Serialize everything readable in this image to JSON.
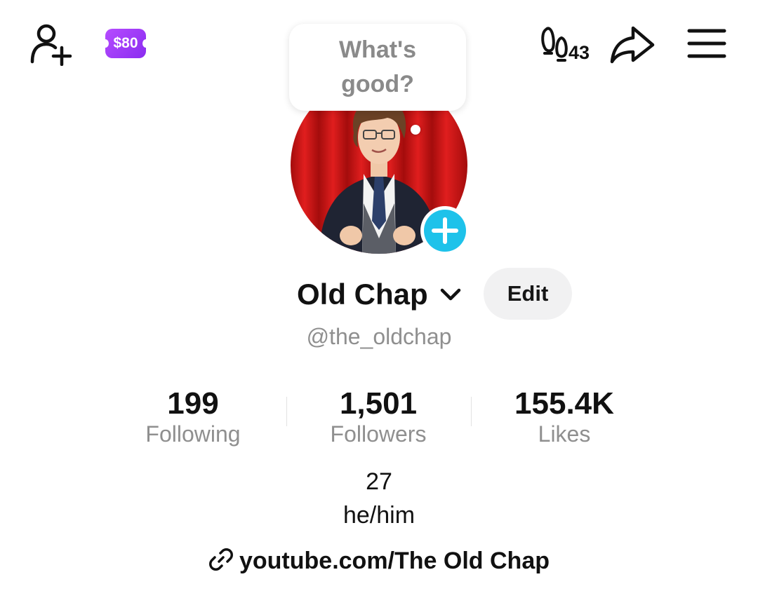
{
  "topbar": {
    "coin_badge": "$80",
    "visitors_count": "43"
  },
  "bubble": {
    "text": "What's good?"
  },
  "profile": {
    "display_name": "Old Chap",
    "edit_label": "Edit",
    "handle": "@the_oldchap"
  },
  "stats": [
    {
      "value": "199",
      "label": "Following"
    },
    {
      "value": "1,501",
      "label": "Followers"
    },
    {
      "value": "155.4K",
      "label": "Likes"
    }
  ],
  "bio": {
    "line1": "27",
    "line2": "he/him"
  },
  "link": {
    "text": "youtube.com/The Old Chap"
  },
  "colors": {
    "accent_blue": "#1ec2ea",
    "coin_purple": "#9b3cf7",
    "muted_text": "#8f8f8f"
  },
  "icons": {
    "add_user": "add-user-icon",
    "visitors": "footprints-icon",
    "share": "share-arrow-icon",
    "menu": "hamburger-menu-icon",
    "chevron": "chevron-down-icon",
    "link": "link-icon",
    "add_story": "plus-circle-icon"
  }
}
